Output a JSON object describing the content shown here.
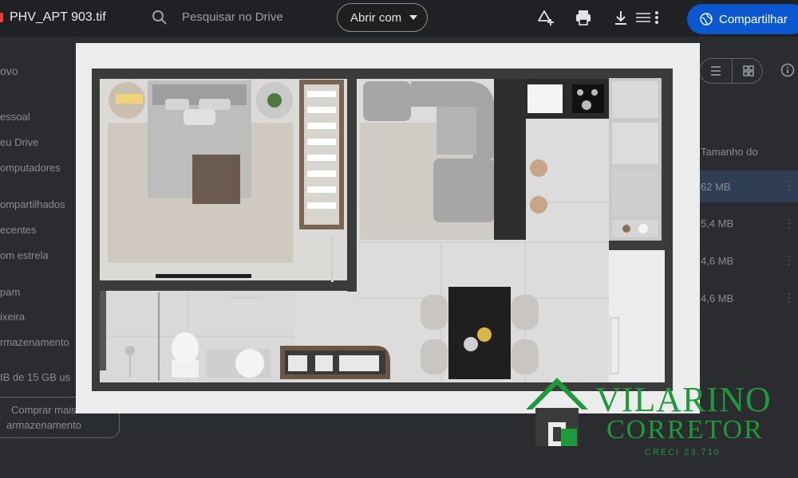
{
  "viewer": {
    "file_name": "PHV_APT 903.tif",
    "search_placeholder": "Pesquisar no Drive",
    "open_with_label": "Abrir com",
    "share_label": "Compartilhar"
  },
  "background_sidebar": {
    "items": [
      "ovo",
      "essoal",
      "eu Drive",
      "omputadores",
      "ompartilhados",
      "ecentes",
      "om estrela",
      "pam",
      "ixeira",
      "rmazenamento",
      "IB de 15 GB us"
    ],
    "storage_button": [
      "Comprar mais",
      "armazenamento"
    ]
  },
  "background_list": {
    "column_header": "Tamanho do",
    "sizes": [
      "62 MB",
      "5,4 MB",
      "4,6 MB",
      "4,6 MB"
    ]
  },
  "watermark": {
    "name": "VILARINO",
    "role": "CORRETOR",
    "creci": "CRECI 23.710",
    "color": "#1f9a3a"
  },
  "colors": {
    "topbar": "#202124",
    "share_button": "#0b57d0",
    "wall": "#3c3c3c",
    "floor": "#d8d8d6"
  }
}
